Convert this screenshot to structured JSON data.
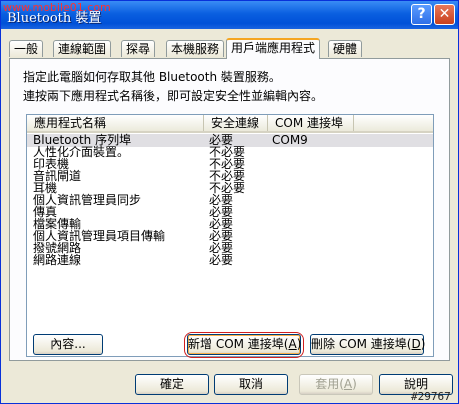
{
  "window": {
    "title": "Bluetooth 裝置",
    "watermark": "www.mobile01.com",
    "help_label": "?",
    "close_label": "✕"
  },
  "tabs": [
    {
      "label": "一般"
    },
    {
      "label": "連線範圍"
    },
    {
      "label": "探尋"
    },
    {
      "label": "本機服務"
    },
    {
      "label": "用戶端應用程式",
      "active": true
    },
    {
      "label": "硬體"
    }
  ],
  "panel": {
    "desc1": "指定此電腦如何存取其他 Bluetooth 裝置服務。",
    "desc2": "連按兩下應用程式名稱後，即可設定安全性並編輯內容。"
  },
  "list": {
    "columns": [
      "應用程式名稱",
      "安全連線",
      "COM 連接埠"
    ],
    "rows": [
      {
        "name": "Bluetooth 序列埠",
        "secure": "必要",
        "com": "COM9",
        "selected": true
      },
      {
        "name": "人性化介面裝置。",
        "secure": "不必要",
        "com": ""
      },
      {
        "name": "印表機",
        "secure": "不必要",
        "com": ""
      },
      {
        "name": "音訊閘道",
        "secure": "不必要",
        "com": ""
      },
      {
        "name": "耳機",
        "secure": "不必要",
        "com": ""
      },
      {
        "name": "個人資訊管理員同步",
        "secure": "必要",
        "com": ""
      },
      {
        "name": "傳真",
        "secure": "必要",
        "com": ""
      },
      {
        "name": "檔案傳輸",
        "secure": "必要",
        "com": ""
      },
      {
        "name": "個人資訊管理員項目傳輸",
        "secure": "必要",
        "com": ""
      },
      {
        "name": "撥號網路",
        "secure": "必要",
        "com": ""
      },
      {
        "name": "網路連線",
        "secure": "必要",
        "com": ""
      }
    ]
  },
  "buttons": {
    "properties": "內容...",
    "add_com_prefix": "新增 COM 連接埠(",
    "add_com_key": "A",
    "add_com_suffix": ")",
    "remove_com_prefix": "刪除 COM 連接埠(",
    "remove_com_key": "D",
    "remove_com_suffix": ")",
    "ok": "確定",
    "cancel": "取消",
    "apply_prefix": "套用(",
    "apply_key": "A",
    "apply_suffix": ")",
    "help": "說明"
  },
  "badge": "#29767",
  "colors": {
    "titlebar": "#0a5fe0",
    "active_tab_accent": "#f5a623",
    "highlight_ring": "#d02020"
  }
}
